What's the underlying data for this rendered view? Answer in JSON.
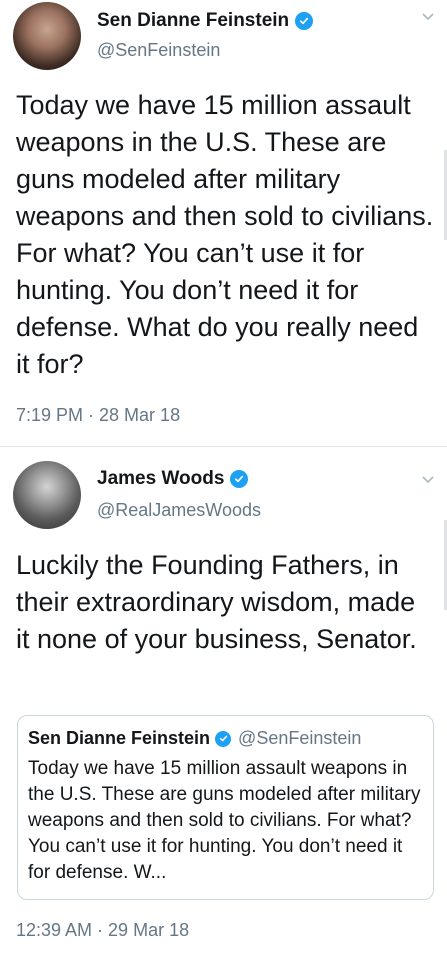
{
  "tweets": [
    {
      "author_name": "Sen Dianne Feinstein",
      "handle": "@SenFeinstein",
      "text": "Today we have 15 million assault weapons in the U.S. These are guns modeled after military weapons and then sold to civilians. For what? You can’t use it for hunting. You don’t need it for defense. What do you really need it for?",
      "timestamp": "7:19 PM · 28 Mar 18"
    },
    {
      "author_name": "James Woods",
      "handle": "@RealJamesWoods",
      "text": "Luckily the Founding Fathers, in their extraordinary wisdom, made it none of your business, Senator.",
      "timestamp": "12:39 AM · 29 Mar 18",
      "quoted": {
        "author_name": "Sen Dianne Feinstein",
        "handle": "@SenFeinstein",
        "text": "Today we have 15 million assault weapons in the U.S. These are guns modeled after military weapons and then sold to civilians. For what? You can’t use it for hunting. You don’t need it for defense. W..."
      }
    }
  ],
  "colors": {
    "verified_badge": "#1da1f2",
    "secondary_text": "#657786",
    "divider": "#e1e8ed"
  },
  "icons": {
    "verified": "verified-badge-icon",
    "menu": "chevron-down-icon"
  }
}
